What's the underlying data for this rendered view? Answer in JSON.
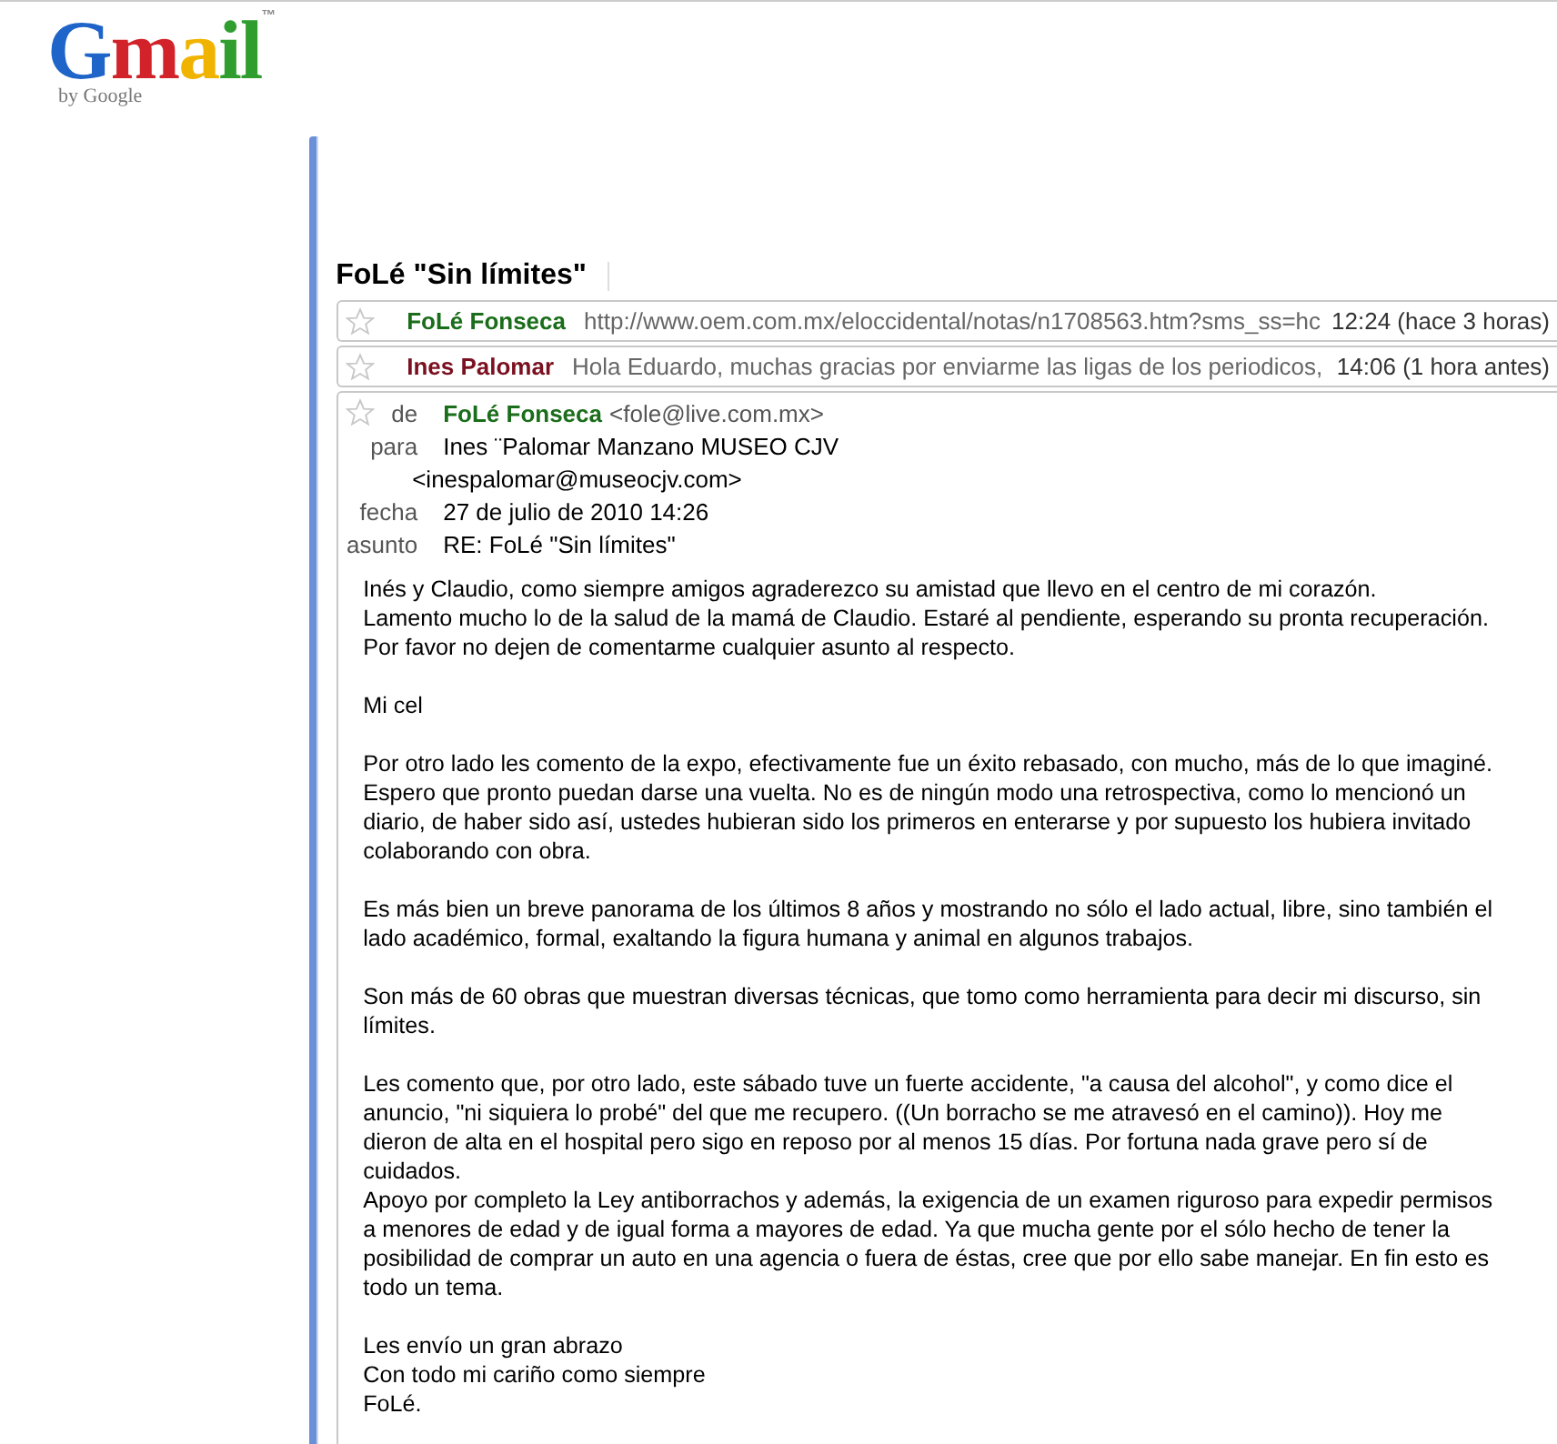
{
  "logo": {
    "text": "Gmail",
    "trademark": "™",
    "tagline": "by Google"
  },
  "thread": {
    "subject": "FoLé \"Sin límites\"",
    "collapsed": [
      {
        "sender": "FoLé Fonseca",
        "color": "#1a6d1a",
        "starred": false,
        "snippet": "http://www.oem.com.mx/eloccidental/notas/n1708563.htm?sms_ss=hc",
        "time": "12:24 (hace 3 horas)"
      },
      {
        "sender": "Ines Palomar",
        "color": "#7a1020",
        "starred": false,
        "snippet": "Hola Eduardo, muchas gracias por enviarme las ligas de los periodicos,",
        "time": "14:06 (1 hora antes)"
      }
    ],
    "open": {
      "starred": false,
      "from_label": "de",
      "from_name": "FoLé Fonseca",
      "from_email": "<fole@live.com.mx>",
      "color": "#1a6d1a",
      "to_label": "para",
      "to_name": "Ines ¨Palomar Manzano MUSEO CJV",
      "to_email": "<inespalomar@museocjv.com>",
      "date_label": "fecha",
      "date": "27 de julio de 2010 14:26",
      "subject_label": "asunto",
      "subject": "RE: FoLé \"Sin límites\"",
      "body": [
        [
          "Inés y Claudio, como siempre amigos agraderezco su amistad que llevo en el centro de mi corazón.",
          "Lamento mucho lo de la salud de la mamá de Claudio. Estaré al pendiente, esperando su pronta recuperación.",
          "Por favor no dejen de comentarme cualquier asunto al respecto."
        ],
        [
          "Mi cel"
        ],
        [
          "Por otro lado les comento de la expo, efectivamente fue un éxito rebasado, con mucho, más de lo que imaginé.",
          "Espero que pronto puedan darse una vuelta. No es de ningún modo una retrospectiva, como lo mencionó un",
          "diario, de haber sido así, ustedes hubieran sido los primeros en enterarse y por supuesto los hubiera invitado",
          "colaborando con obra."
        ],
        [
          "Es más bien un breve panorama de los últimos 8 años y mostrando no sólo el lado actual, libre, sino también el",
          "lado académico, formal, exaltando la figura humana y animal en algunos trabajos."
        ],
        [
          "Son más de 60 obras que muestran diversas técnicas, que tomo como herramienta para decir mi discurso, sin",
          "límites."
        ],
        [
          "Les comento que, por otro lado, este sábado tuve un fuerte accidente, \"a causa del alcohol\", y como dice el",
          "anuncio, \"ni siquiera lo probé\" del que me recupero. ((Un borracho se me atravesó en el camino)). Hoy me",
          "dieron de alta en el hospital pero sigo en reposo por al menos 15 días. Por fortuna nada grave pero sí de",
          "cuidados.",
          "Apoyo por completo la Ley antiborrachos y además, la exigencia de un examen riguroso para expedir permisos",
          "a menores de edad y de igual forma a mayores de edad. Ya que mucha gente por el sólo hecho de tener la",
          "posibilidad de comprar un auto en una agencia o fuera de éstas, cree que por ello sabe manejar. En fin esto es",
          "todo un tema."
        ],
        [
          "Les envío un gran abrazo",
          "Con todo mi cariño como siempre",
          "FoLé."
        ]
      ]
    }
  }
}
